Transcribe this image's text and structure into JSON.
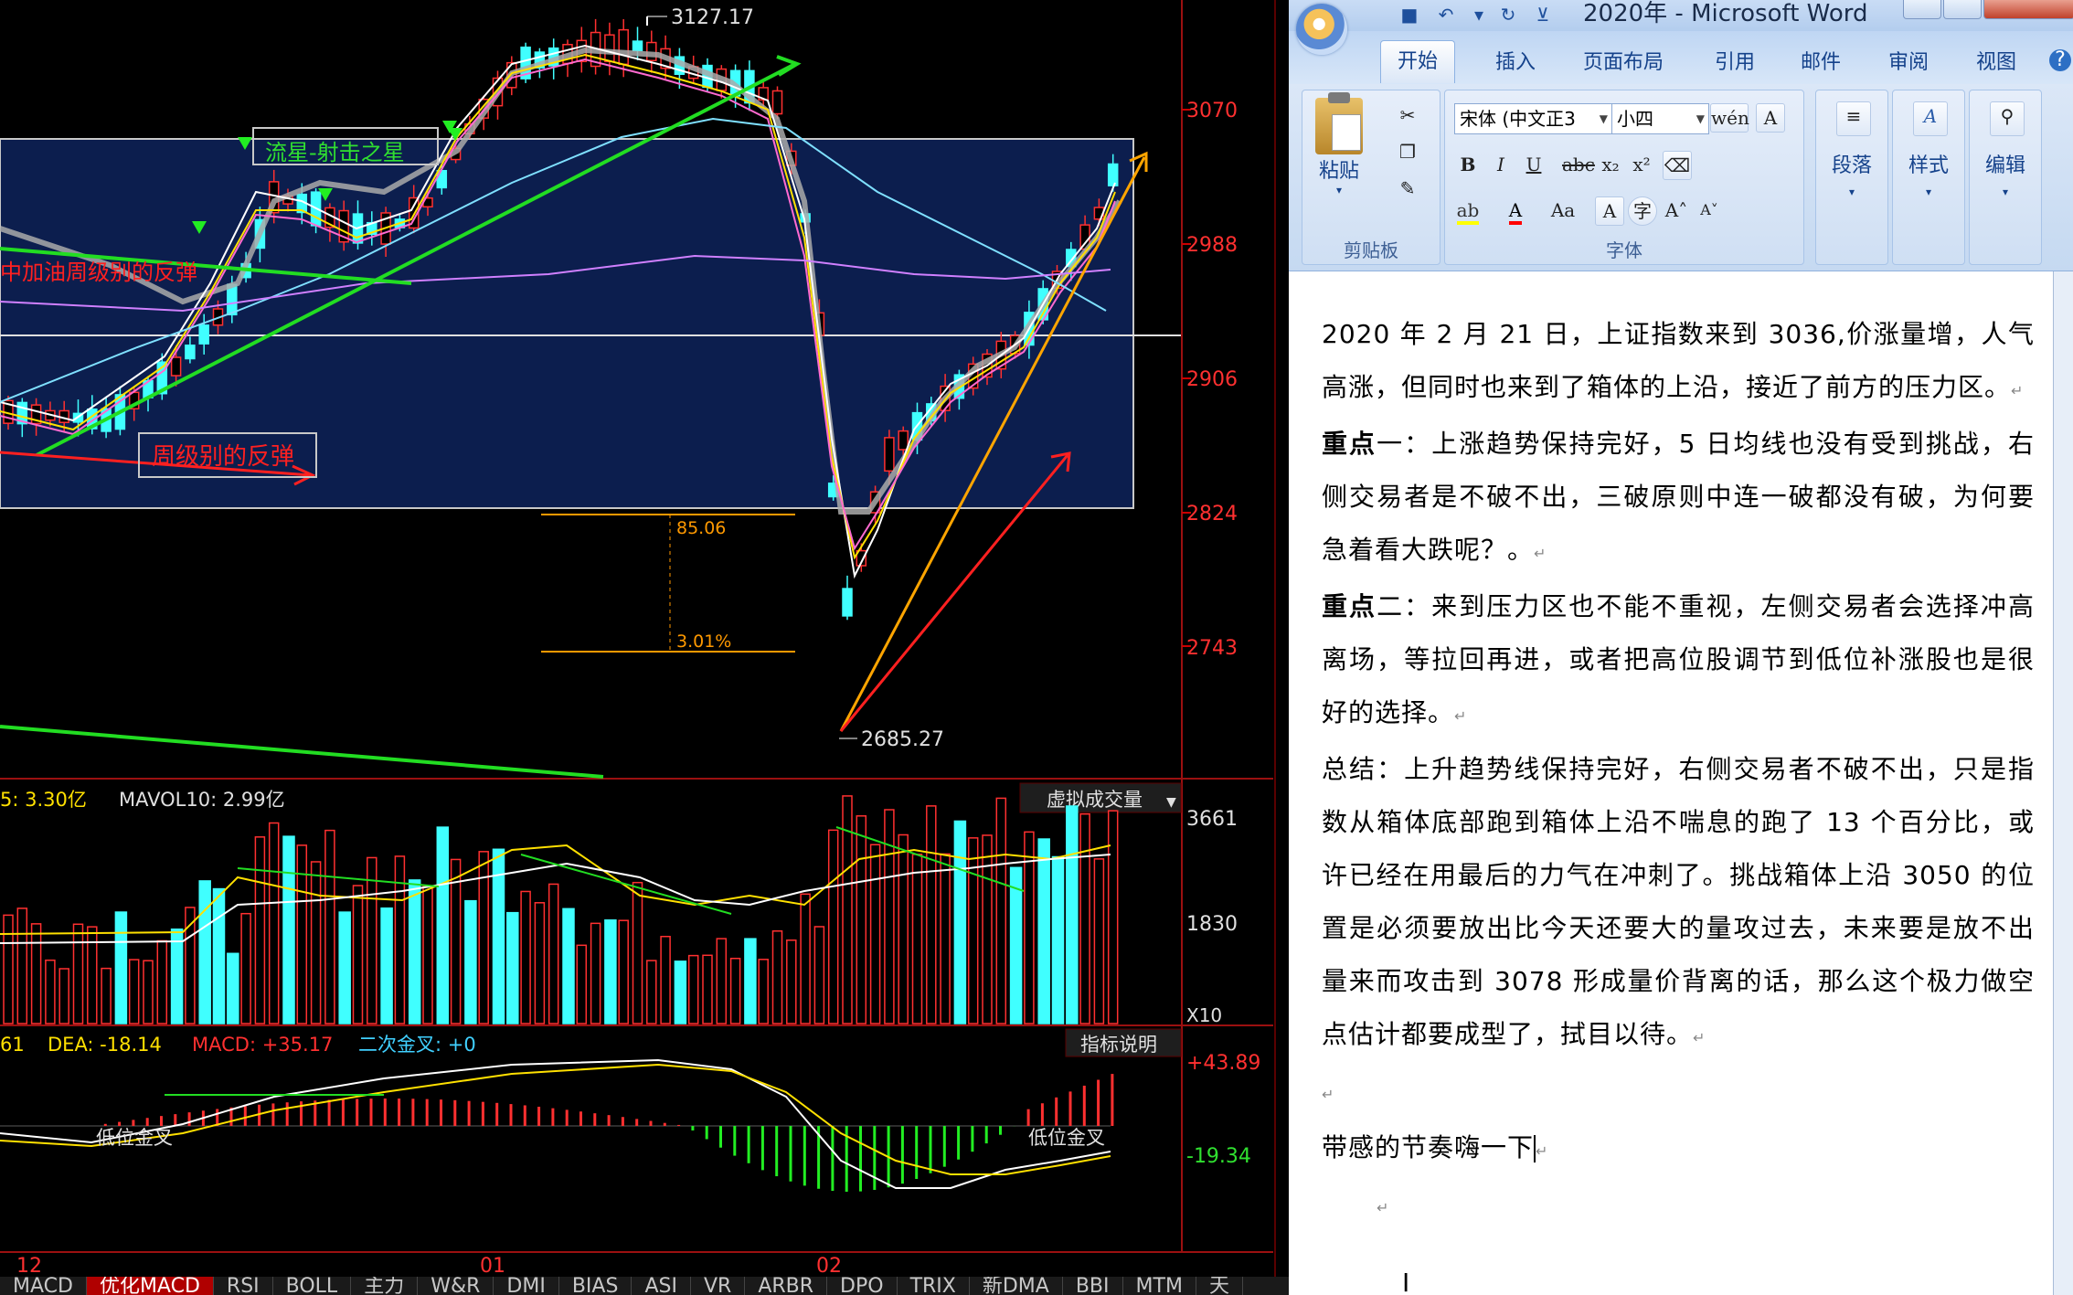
{
  "chart": {
    "price_labels": [
      "3070",
      "2988",
      "2906",
      "2824",
      "2743"
    ],
    "high_label": "3127.17",
    "low_label": "2685.27",
    "measure_labels": [
      "85.06",
      "3.01%"
    ],
    "annotations": [
      "流星-射击之星",
      "中加油周级别的反弹",
      "周级别的反弹"
    ],
    "volume": {
      "header_left": "5: 3.30亿",
      "header_mavol": "MAVOL10: 2.99亿",
      "dropdown": "虚拟成交量",
      "levels": [
        "3661",
        "1830"
      ],
      "unit": "X10"
    },
    "macd": {
      "header_left": "61",
      "dea": "DEA: -18.14",
      "macd": "MACD: +35.17",
      "cross": "二次金叉: +0",
      "help": "指标说明",
      "levels": [
        "+43.89",
        "-19.34"
      ],
      "labels": [
        "低位金叉",
        "低位金叉"
      ]
    },
    "x_labels": [
      "12",
      "01",
      "02"
    ],
    "bottom_tabs": [
      "MACD",
      "优化MACD",
      "RSI",
      "BOLL",
      "主力",
      "W&R",
      "DMI",
      "BIAS",
      "ASI",
      "VR",
      "ARBR",
      "DPO",
      "TRIX",
      "新DMA",
      "BBI",
      "MTM",
      "天"
    ]
  },
  "word": {
    "title": "2020年 - Microsoft Word",
    "tabs": [
      "开始",
      "插入",
      "页面布局",
      "引用",
      "邮件",
      "审阅",
      "视图"
    ],
    "clipboard": {
      "paste": "粘贴",
      "label": "剪贴板"
    },
    "font": {
      "name": "宋体 (中文正3",
      "size": "小四",
      "label": "字体"
    },
    "groups": {
      "paragraph": "段落",
      "styles": "样式",
      "editing": "编辑"
    },
    "doc": {
      "p1": "2020 年 2 月 21 日，上证指数来到 3036,价涨量增，人气高涨，但同时也来到了箱体的上沿，接近了前方的压力区。",
      "p2_bold": "重点",
      "p2_rest": "一：上涨趋势保持完好，5 日均线也没有受到挑战，右侧交易者是不破不出，三破原则中连一破都没有破，为何要急着看大跌呢？。",
      "p3_bold": "重点",
      "p3_rest": "二：来到压力区也不能不重视，左侧交易者会选择冲高离场，等拉回再进，或者把高位股调节到低位补涨股也是很好的选择。",
      "p4": "总结：上升趋势线保持完好，右侧交易者不破不出，只是指数从箱体底部跑到箱体上沿不喘息的跑了 13 个百分比，或许已经在用最后的力气在冲刺了。挑战箱体上沿 3050 的位置是必须要放出比今天还要大的量攻过去，未来要是放不出量来而攻击到 3078 形成量价背离的话，那么这个极力做空点估计都要成型了，拭目以待。",
      "p5": "带感的节奏嗨一下"
    }
  }
}
